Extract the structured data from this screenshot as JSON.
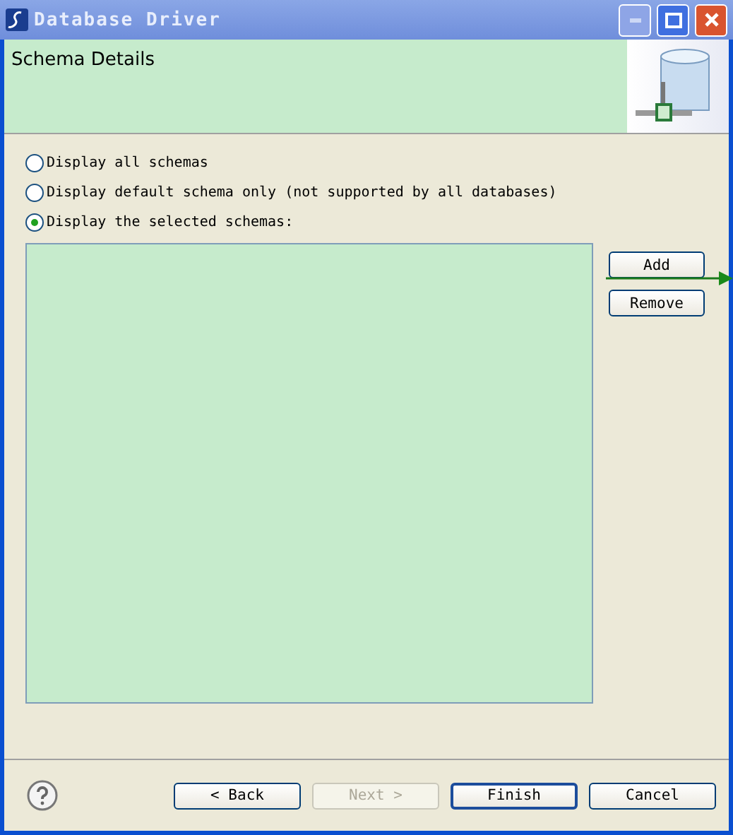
{
  "window": {
    "title": "Database Driver"
  },
  "header": {
    "title": "Schema Details"
  },
  "options": [
    {
      "label": "Display all schemas",
      "selected": false
    },
    {
      "label": "Display default schema only (not supported by all databases)",
      "selected": false
    },
    {
      "label": "Display the selected schemas:",
      "selected": true
    }
  ],
  "side_buttons": [
    "Add",
    "Remove"
  ],
  "footer_buttons": [
    {
      "label": "< Back",
      "disabled": false,
      "default": false
    },
    {
      "label": "Next >",
      "disabled": true,
      "default": false
    },
    {
      "label": "Finish",
      "disabled": false,
      "default": true
    },
    {
      "label": "Cancel",
      "disabled": false,
      "default": false
    }
  ]
}
